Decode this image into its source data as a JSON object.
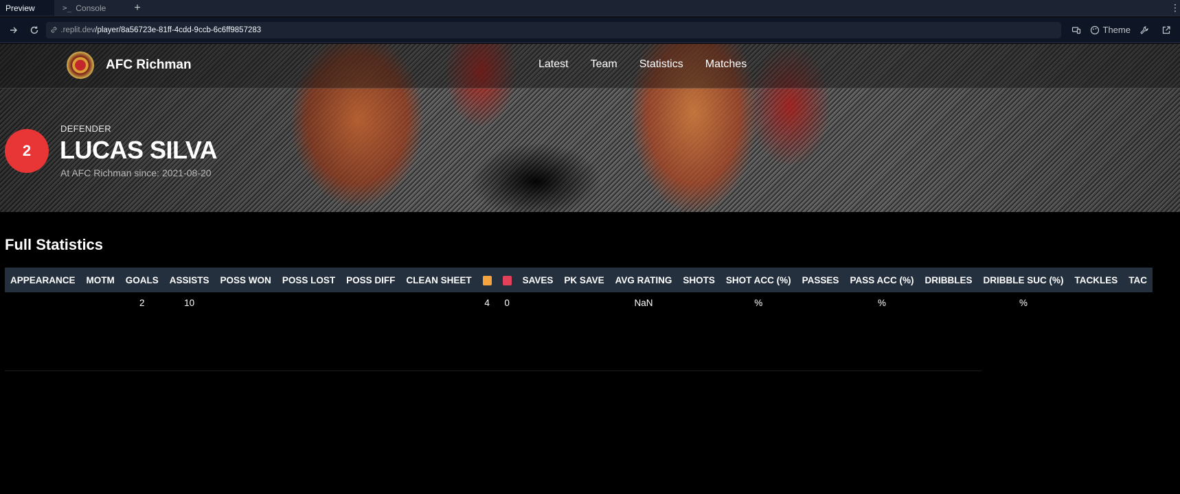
{
  "browser": {
    "tabs": [
      {
        "label": "Preview",
        "active": true
      },
      {
        "label": "Console",
        "active": false
      }
    ],
    "url_host": ".replit.dev",
    "url_path": "/player/8a56723e-81ff-4cdd-9ccb-6c6ff9857283",
    "theme_label": "Theme"
  },
  "site": {
    "brand": "AFC Richman",
    "nav": [
      "Latest",
      "Team",
      "Statistics",
      "Matches"
    ]
  },
  "player": {
    "number": "2",
    "position": "DEFENDER",
    "name": "LUCAS SILVA",
    "since_label": "At AFC Richman since:",
    "since_date": "2021-08-20"
  },
  "stats": {
    "title": "Full Statistics",
    "headers": [
      "APPEARANCE",
      "MOTM",
      "GOALS",
      "ASSISTS",
      "POSS WON",
      "POSS LOST",
      "POSS DIFF",
      "CLEAN SHEET",
      "",
      "",
      "SAVES",
      "PK SAVE",
      "AVG RATING",
      "SHOTS",
      "SHOT ACC (%)",
      "PASSES",
      "PASS ACC (%)",
      "DRIBBLES",
      "DRIBBLE SUC (%)",
      "TACKLES",
      "TAC"
    ],
    "card_colors": {
      "yellow": "#f5a33c",
      "red": "#e3405a"
    },
    "row": [
      "",
      "",
      "2",
      "10",
      "",
      "",
      "",
      "",
      "4",
      "0",
      "",
      "",
      "NaN",
      "",
      "%",
      "",
      "%",
      "",
      "%",
      "",
      ""
    ]
  },
  "colors": {
    "header_bg": "#25303f",
    "badge": "#e83535"
  }
}
